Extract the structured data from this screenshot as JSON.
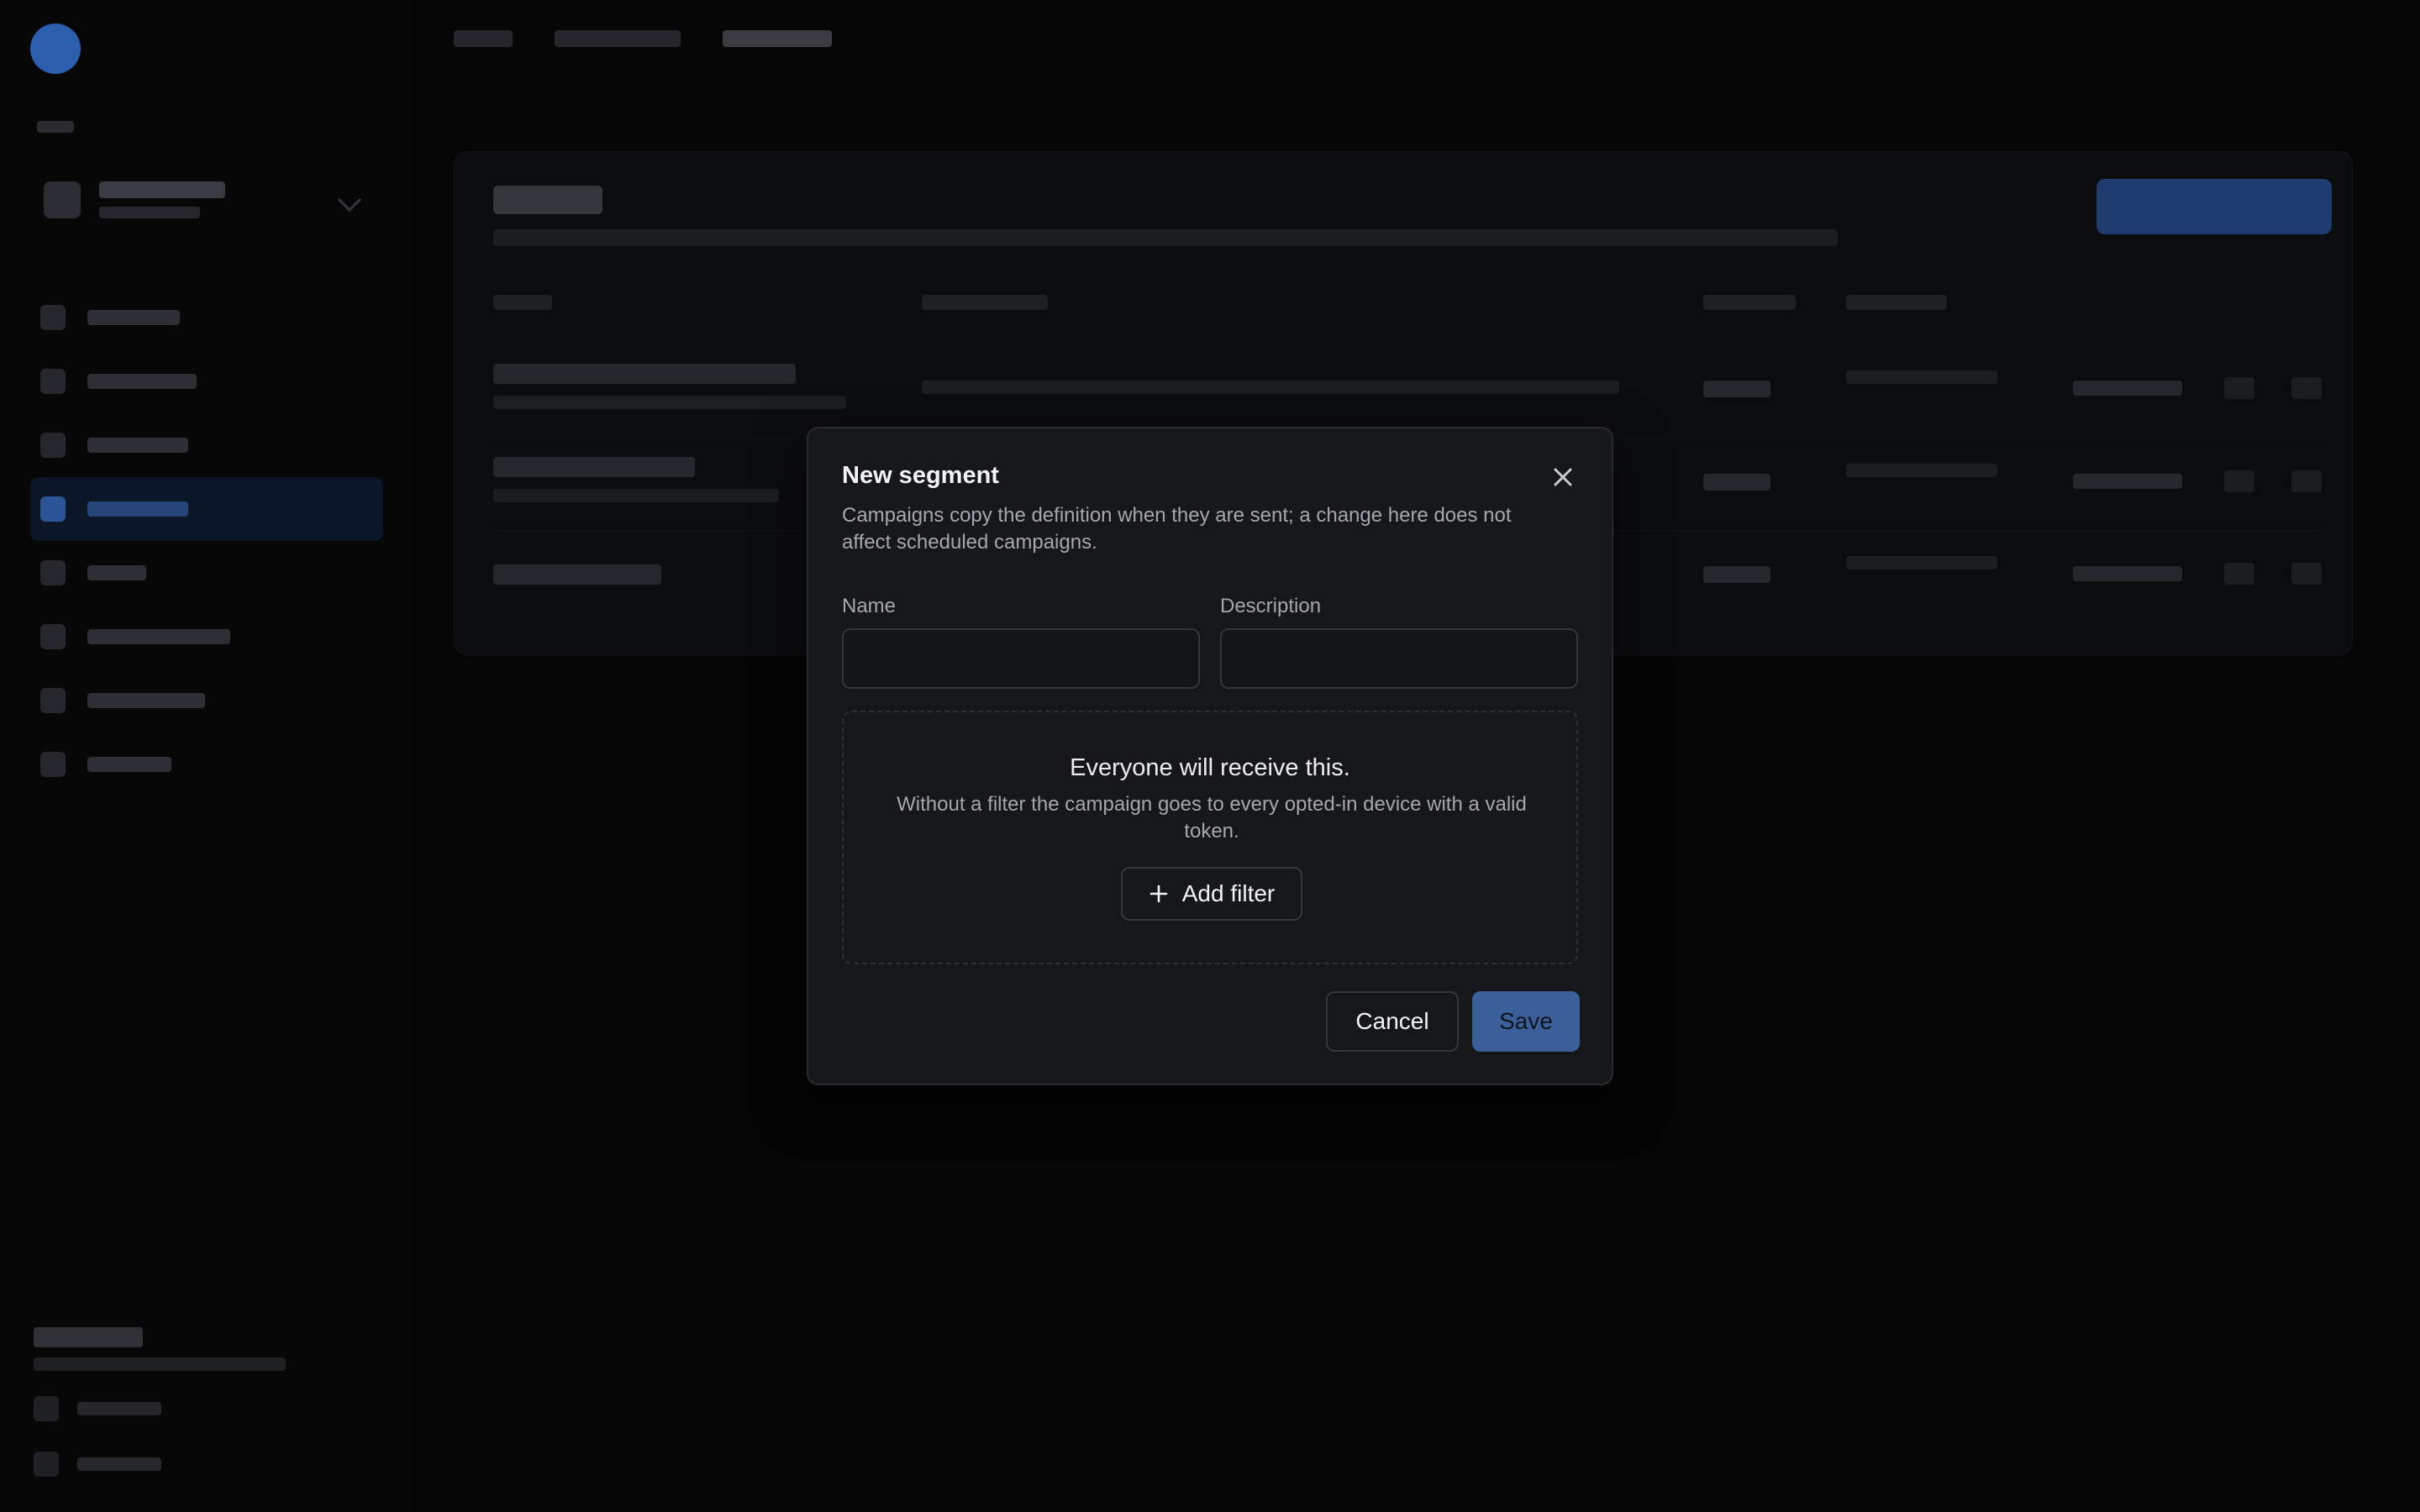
{
  "modal": {
    "title": "New segment",
    "description": "Campaigns copy the definition when they are sent; a change here does not affect scheduled campaigns.",
    "name_label": "Name",
    "name_value": "",
    "description_label": "Description",
    "description_value": "",
    "empty_filter": {
      "title": "Everyone will receive this.",
      "description": "Without a filter the campaign goes to every opted-in device with a valid token.",
      "add_filter_label": "Add filter"
    },
    "cancel_label": "Cancel",
    "save_label": "Save"
  },
  "colors": {
    "accent": "#3b5f98",
    "modal_bg": "#161719",
    "backdrop": "#050506"
  },
  "icons": {
    "close": "close-icon",
    "add": "plus-icon"
  }
}
